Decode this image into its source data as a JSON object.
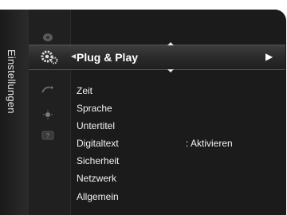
{
  "side_tab": {
    "label": "Einstellungen"
  },
  "icons": [
    "disc-icon",
    "gear-icon",
    "satellite-icon",
    "sun-icon",
    "question-icon"
  ],
  "menu": {
    "highlighted": {
      "label": "Plug & Play"
    },
    "items": [
      {
        "label": "Zeit",
        "value": ""
      },
      {
        "label": "Sprache",
        "value": ""
      },
      {
        "label": "Untertitel",
        "value": ""
      },
      {
        "label": "Digitaltext",
        "value": ": Aktivieren"
      },
      {
        "label": "Sicherheit",
        "value": ""
      },
      {
        "label": "Netzwerk",
        "value": ""
      },
      {
        "label": "Allgemein",
        "value": ""
      }
    ]
  },
  "colors": {
    "panel": "#1b1b1b",
    "text": "#f2f2f2",
    "highlight": "#3e3e3e"
  }
}
